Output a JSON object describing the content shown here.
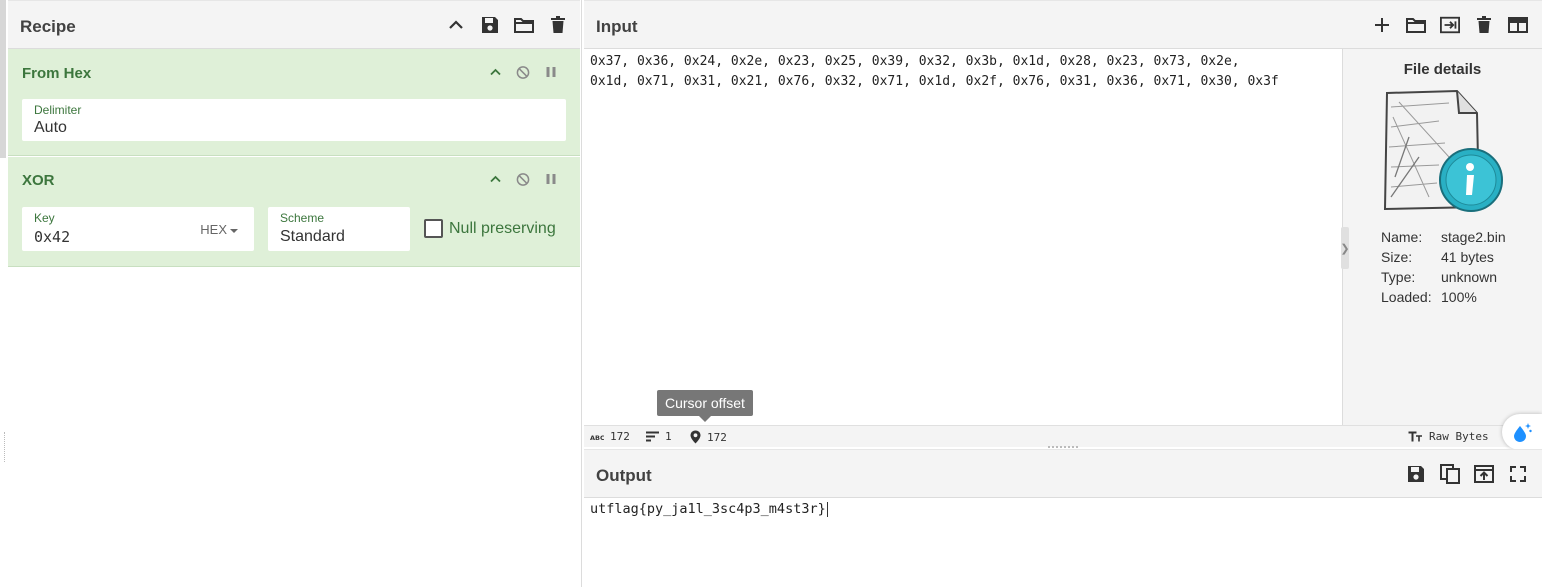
{
  "recipe": {
    "title": "Recipe",
    "operations": [
      {
        "name": "From Hex",
        "fields": {
          "delimiter_label": "Delimiter",
          "delimiter_value": "Auto"
        }
      },
      {
        "name": "XOR",
        "fields": {
          "key_label": "Key",
          "key_value": "0x42",
          "key_format": "HEX",
          "scheme_label": "Scheme",
          "scheme_value": "Standard",
          "null_preserving_label": "Null preserving",
          "null_preserving_checked": false
        }
      }
    ]
  },
  "input": {
    "title": "Input",
    "lines": [
      "0x37, 0x36, 0x24, 0x2e, 0x23, 0x25, 0x39, 0x32, 0x3b, 0x1d, 0x28, 0x23, 0x73, 0x2e,",
      "0x1d, 0x71, 0x31, 0x21, 0x76, 0x32, 0x71, 0x1d, 0x2f, 0x76, 0x31, 0x36, 0x71, 0x30, 0x3f"
    ],
    "file_details": {
      "title": "File details",
      "name_label": "Name:",
      "name": "stage2.bin",
      "size_label": "Size:",
      "size": "41 bytes",
      "type_label": "Type:",
      "type": "unknown",
      "loaded_label": "Loaded:",
      "loaded": "100%"
    },
    "tooltip": "Cursor offset",
    "status": {
      "length": "172",
      "lines": "1",
      "cursor_offset": "172",
      "encoding": "Raw Bytes"
    }
  },
  "output": {
    "title": "Output",
    "text": "utflag{py_ja1l_3sc4p3_m4st3r}"
  },
  "colors": {
    "op_background": "#dff0d8",
    "op_text": "#3c763d",
    "header_background": "#f4f4f4",
    "magic_accent": "#1e90ff"
  }
}
